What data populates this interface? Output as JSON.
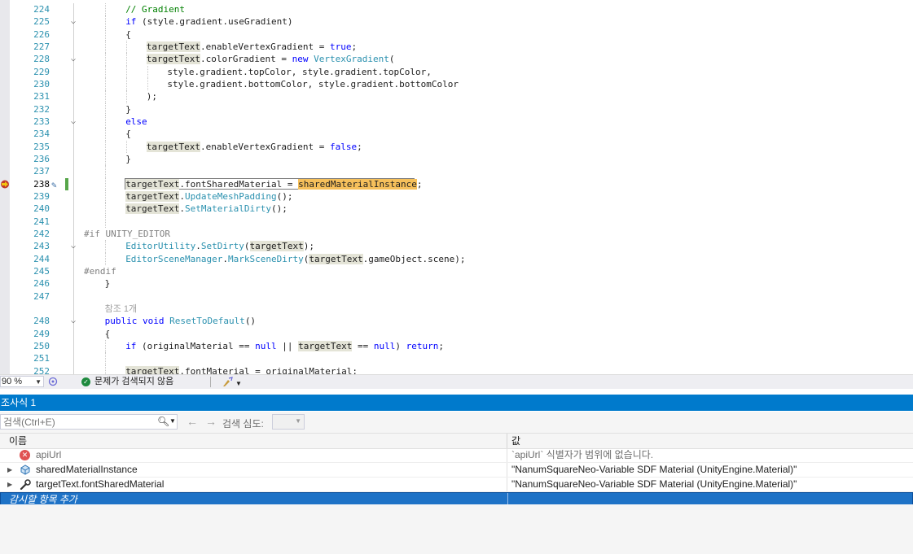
{
  "editor": {
    "lines": [
      {
        "n": "224",
        "indent": 2,
        "tokens": [
          {
            "t": "// Gradient",
            "c": "cm"
          }
        ]
      },
      {
        "n": "225",
        "indent": 2,
        "fold": "v",
        "tokens": [
          {
            "t": "if",
            "c": "kw"
          },
          {
            "t": " (style.gradient.useGradient)"
          }
        ]
      },
      {
        "n": "226",
        "indent": 2,
        "tokens": [
          {
            "t": "{"
          }
        ]
      },
      {
        "n": "227",
        "indent": 3,
        "tokens": [
          {
            "t": "targetText",
            "c": "hl"
          },
          {
            "t": ".enableVertexGradient = "
          },
          {
            "t": "true",
            "c": "kw"
          },
          {
            "t": ";"
          }
        ]
      },
      {
        "n": "228",
        "indent": 3,
        "fold": "v",
        "tokens": [
          {
            "t": "targetText",
            "c": "hl"
          },
          {
            "t": ".colorGradient = "
          },
          {
            "t": "new",
            "c": "kw"
          },
          {
            "t": " "
          },
          {
            "t": "VertexGradient",
            "c": "ty"
          },
          {
            "t": "("
          }
        ]
      },
      {
        "n": "229",
        "indent": 4,
        "tokens": [
          {
            "t": "style.gradient.topColor, style.gradient.topColor,"
          }
        ]
      },
      {
        "n": "230",
        "indent": 4,
        "tokens": [
          {
            "t": "style.gradient.bottomColor, style.gradient.bottomColor"
          }
        ]
      },
      {
        "n": "231",
        "indent": 3,
        "tokens": [
          {
            "t": ");"
          }
        ]
      },
      {
        "n": "232",
        "indent": 2,
        "tokens": [
          {
            "t": "}"
          }
        ]
      },
      {
        "n": "233",
        "indent": 2,
        "fold": "v",
        "tokens": [
          {
            "t": "else",
            "c": "kw"
          }
        ]
      },
      {
        "n": "234",
        "indent": 2,
        "tokens": [
          {
            "t": "{"
          }
        ]
      },
      {
        "n": "235",
        "indent": 3,
        "tokens": [
          {
            "t": "targetText",
            "c": "hl"
          },
          {
            "t": ".enableVertexGradient = "
          },
          {
            "t": "false",
            "c": "kw"
          },
          {
            "t": ";"
          }
        ]
      },
      {
        "n": "236",
        "indent": 2,
        "tokens": [
          {
            "t": "}"
          }
        ]
      },
      {
        "n": "237",
        "indent": 2,
        "tokens": []
      },
      {
        "n": "238",
        "indent": 2,
        "current": true,
        "tokens": [
          {
            "t": "targetText",
            "c": "hl"
          },
          {
            "t": ".fontSharedMaterial = "
          },
          {
            "t": "sharedMaterialInstance",
            "c": "curhl"
          },
          {
            "t": ";"
          }
        ]
      },
      {
        "n": "239",
        "indent": 2,
        "tokens": [
          {
            "t": "targetText",
            "c": "hl"
          },
          {
            "t": "."
          },
          {
            "t": "UpdateMeshPadding",
            "c": "ty"
          },
          {
            "t": "();"
          }
        ]
      },
      {
        "n": "240",
        "indent": 2,
        "tokens": [
          {
            "t": "targetText",
            "c": "hl"
          },
          {
            "t": "."
          },
          {
            "t": "SetMaterialDirty",
            "c": "ty"
          },
          {
            "t": "();"
          }
        ]
      },
      {
        "n": "241",
        "indent": 2,
        "tokens": []
      },
      {
        "n": "242",
        "indent": 0,
        "tokens": [
          {
            "t": "#if UNITY_EDITOR",
            "c": "pp"
          }
        ]
      },
      {
        "n": "243",
        "indent": 2,
        "fold": "v",
        "tokens": [
          {
            "t": "EditorUtility",
            "c": "ty"
          },
          {
            "t": "."
          },
          {
            "t": "SetDirty",
            "c": "ty"
          },
          {
            "t": "("
          },
          {
            "t": "targetText",
            "c": "hl"
          },
          {
            "t": ");"
          }
        ]
      },
      {
        "n": "244",
        "indent": 2,
        "tokens": [
          {
            "t": "EditorSceneManager",
            "c": "ty"
          },
          {
            "t": "."
          },
          {
            "t": "MarkSceneDirty",
            "c": "ty"
          },
          {
            "t": "("
          },
          {
            "t": "targetText",
            "c": "hl"
          },
          {
            "t": ".gameObject.scene);"
          }
        ]
      },
      {
        "n": "245",
        "indent": 0,
        "tokens": [
          {
            "t": "#endif",
            "c": "pp"
          }
        ]
      },
      {
        "n": "246",
        "indent": 1,
        "tokens": [
          {
            "t": "}"
          }
        ]
      },
      {
        "n": "247",
        "indent": 1,
        "tokens": []
      },
      {
        "n": "",
        "indent": 1,
        "tokens": [
          {
            "t": "참조 1개",
            "c": "ref"
          }
        ]
      },
      {
        "n": "248",
        "indent": 1,
        "fold": "v",
        "tokens": [
          {
            "t": "public",
            "c": "kw"
          },
          {
            "t": " "
          },
          {
            "t": "void",
            "c": "kw"
          },
          {
            "t": " "
          },
          {
            "t": "ResetToDefault",
            "c": "ty"
          },
          {
            "t": "()"
          }
        ]
      },
      {
        "n": "249",
        "indent": 1,
        "tokens": [
          {
            "t": "{"
          }
        ]
      },
      {
        "n": "250",
        "indent": 2,
        "tokens": [
          {
            "t": "if",
            "c": "kw"
          },
          {
            "t": " (originalMaterial == "
          },
          {
            "t": "null",
            "c": "kw"
          },
          {
            "t": " || "
          },
          {
            "t": "targetText",
            "c": "hl"
          },
          {
            "t": " == "
          },
          {
            "t": "null",
            "c": "kw"
          },
          {
            "t": ") "
          },
          {
            "t": "return",
            "c": "kw"
          },
          {
            "t": ";"
          }
        ]
      },
      {
        "n": "251",
        "indent": 2,
        "tokens": []
      },
      {
        "n": "252",
        "indent": 2,
        "tokens": [
          {
            "t": "targetText",
            "c": "hl"
          },
          {
            "t": ".fontMaterial = originalMaterial;"
          }
        ]
      }
    ]
  },
  "statusbar": {
    "zoom": "90 %",
    "issues_text": "문제가 검색되지 않음"
  },
  "watch": {
    "title": "조사식 1",
    "search_placeholder": "검색(Ctrl+E)",
    "depth_label": "검색 심도:",
    "columns": {
      "name": "이름",
      "value": "값"
    },
    "rows": [
      {
        "name": "apiUrl",
        "value": "`apiUrl` 식별자가 범위에 없습니다.",
        "icon": "error-icon",
        "expandable": false,
        "dim": true
      },
      {
        "name": "sharedMaterialInstance",
        "value": "\"NanumSquareNeo-Variable SDF Material (UnityEngine.Material)\"",
        "icon": "object-icon",
        "expandable": true,
        "dim": false
      },
      {
        "name": "targetText.fontSharedMaterial",
        "value": "\"NanumSquareNeo-Variable SDF Material (UnityEngine.Material)\"",
        "icon": "wrench-icon",
        "expandable": true,
        "dim": false
      }
    ],
    "add_item_label": "감시할 항목 추가"
  }
}
